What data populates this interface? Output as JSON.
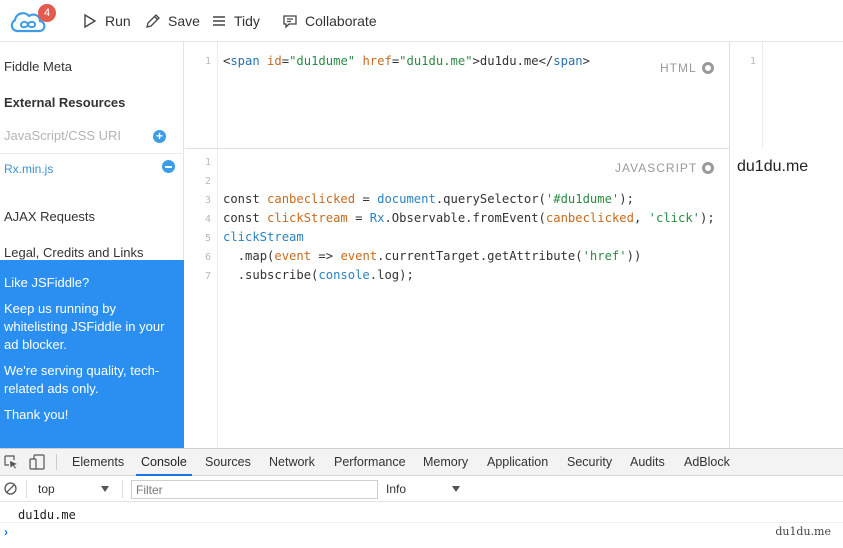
{
  "toolbar": {
    "logo_badge": "4",
    "run_label": "Run",
    "save_label": "Save",
    "tidy_label": "Tidy",
    "collaborate_label": "Collaborate"
  },
  "sidebar": {
    "fiddle_meta": "Fiddle Meta",
    "external_resources": "External Resources",
    "resource_input_placeholder": "JavaScript/CSS URI",
    "resource_file": "Rx.min.js",
    "ajax_requests": "AJAX Requests",
    "legal": "Legal, Credits and Links"
  },
  "promo": {
    "line1": "Like JSFiddle?",
    "line2": "Keep us running by whitelisting JSFiddle in your ad blocker.",
    "line3": "We're serving quality, tech-related ads only.",
    "line4": "Thank you!"
  },
  "html_panel": {
    "label": "HTML",
    "line_number": "1",
    "code": {
      "open_lt": "<",
      "tag": "span",
      "attr1": "id",
      "eq1": "=",
      "val1": "\"du1dume\"",
      "attr2": "href",
      "eq2": "=",
      "val2": "\"du1du.me\"",
      "close_gt": ">",
      "text": "du1du.me",
      "end_lt": "</",
      "end_tag": "span",
      "end_gt": ">"
    }
  },
  "js_panel": {
    "label": "JAVASCRIPT",
    "line_numbers": [
      "1",
      "2",
      "3",
      "4",
      "5",
      "6",
      "7"
    ],
    "line3": {
      "kw": "const",
      "var": "canbeclicked",
      "eq": "=",
      "obj": "document",
      "rest": ".querySelector(",
      "str": "'#du1dume'",
      "end": ");"
    },
    "line4": {
      "kw": "const",
      "var": "clickStream",
      "eq": "=",
      "obj": "Rx",
      "rest": ".Observable.fromEvent(",
      "arg": "canbeclicked",
      "comma": ",",
      "str": "'click'",
      "end": ");"
    },
    "line5": {
      "obj": "clickStream"
    },
    "line6": {
      "pre": ".map(",
      "arg": "event",
      "arrow": "=>",
      "obj": "event",
      "rest": ".currentTarget.getAttribute(",
      "str": "'href'",
      "end": "))"
    },
    "line7": {
      "pre": ".subscribe(",
      "obj": "console",
      "rest": ".log);"
    }
  },
  "result": {
    "line_number": "1",
    "text": "du1du.me"
  },
  "devtools": {
    "tabs": [
      "Elements",
      "Console",
      "Sources",
      "Network",
      "Performance",
      "Memory",
      "Application",
      "Security",
      "Audits",
      "AdBlock"
    ],
    "active_tab": "Console",
    "context_select": "top",
    "filter_placeholder": "Filter",
    "level_select": "Info",
    "console_output": "du1du.me",
    "console_source": "du1du.me",
    "prompt": "›"
  },
  "colors": {
    "promo_bg": "#2a8ff0",
    "accent": "#3c9ce6",
    "badge": "#e25b4e",
    "devtools_active": "#1a73e8"
  },
  "icons": [
    "jsfiddle-logo-icon",
    "play-icon",
    "pencil-icon",
    "tidy-lines-icon",
    "chat-icon",
    "plus-circle-icon",
    "minus-circle-icon",
    "gear-icon",
    "inspect-icon",
    "device-icon",
    "clear-console-icon"
  ]
}
